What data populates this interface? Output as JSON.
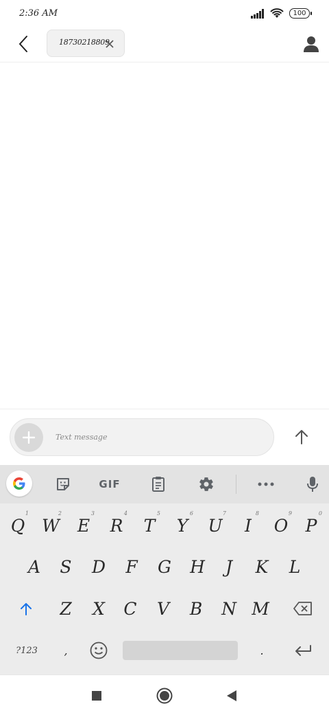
{
  "status_bar": {
    "time": "2:36 AM",
    "battery": "100"
  },
  "header": {
    "recipient": "18730218809"
  },
  "compose": {
    "placeholder": "Text message"
  },
  "keyboard": {
    "toolbar": {
      "gif_label": "GIF"
    },
    "row1": [
      {
        "key": "Q",
        "hint": "1"
      },
      {
        "key": "W",
        "hint": "2"
      },
      {
        "key": "E",
        "hint": "3"
      },
      {
        "key": "R",
        "hint": "4"
      },
      {
        "key": "T",
        "hint": "5"
      },
      {
        "key": "Y",
        "hint": "6"
      },
      {
        "key": "U",
        "hint": "7"
      },
      {
        "key": "I",
        "hint": "8"
      },
      {
        "key": "O",
        "hint": "9"
      },
      {
        "key": "P",
        "hint": "0"
      }
    ],
    "row2": [
      "A",
      "S",
      "D",
      "F",
      "G",
      "H",
      "J",
      "K",
      "L"
    ],
    "row3": [
      "Z",
      "X",
      "C",
      "V",
      "B",
      "N",
      "M"
    ],
    "row4": {
      "symbols": "?123",
      "comma": ",",
      "period": "."
    }
  },
  "colors": {
    "shift_accent": "#1a73e8",
    "keyboard_bg": "#ececec",
    "toolbar_bg": "#e3e3e3"
  }
}
